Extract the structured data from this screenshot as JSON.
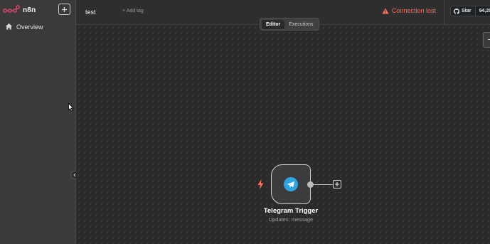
{
  "app": {
    "name": "n8n"
  },
  "sidebar": {
    "items": [
      {
        "label": "Overview",
        "icon": "home-icon"
      }
    ]
  },
  "header": {
    "workflow_name": "test",
    "add_tag_label": "+ Add tag",
    "connection_status": "Connection lost",
    "github": {
      "star_label": "Star",
      "count": "94,20"
    }
  },
  "canvas": {
    "tabs": [
      {
        "label": "Editor",
        "active": true
      },
      {
        "label": "Executions",
        "active": false
      }
    ],
    "node": {
      "title": "Telegram Trigger",
      "subtitle": "Updates: message",
      "icon": "telegram-icon"
    }
  },
  "colors": {
    "accent": "#ff6d5a",
    "telegram": "#2ca5e0",
    "canvas_bg": "#2b2b2b",
    "sidebar_bg": "#3a3a3b"
  }
}
